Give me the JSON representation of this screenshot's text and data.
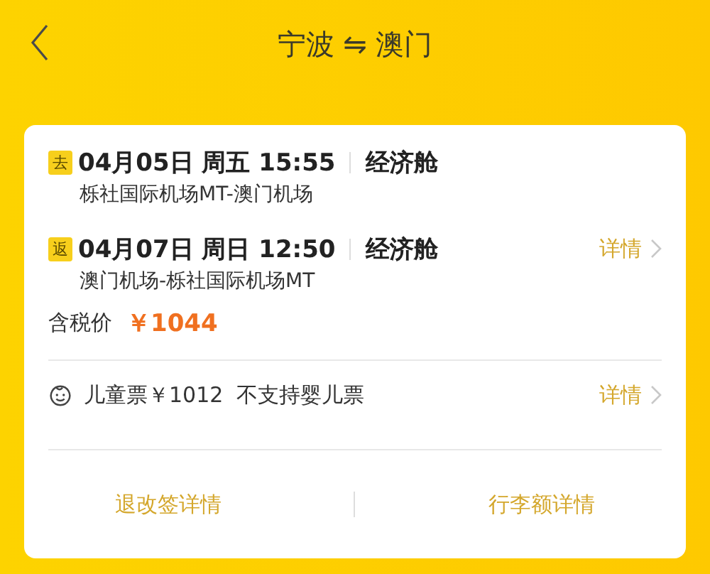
{
  "header": {
    "title": "宁波 ⇋ 澳门"
  },
  "flights": [
    {
      "badge": "去",
      "datetime": "04月05日 周五 15:55",
      "cabin": "经济舱",
      "route": "栎社国际机场MT-澳门机场"
    },
    {
      "badge": "返",
      "datetime": "04月07日 周日 12:50",
      "cabin": "经济舱",
      "route": "澳门机场-栎社国际机场MT",
      "link": "详情"
    }
  ],
  "price": {
    "label": "含税价",
    "amount": "￥1044"
  },
  "child_ticket": {
    "text": "儿童票￥1012  不支持婴儿票",
    "link": "详情"
  },
  "footer_links": [
    "退改签详情",
    "行李额详情"
  ]
}
